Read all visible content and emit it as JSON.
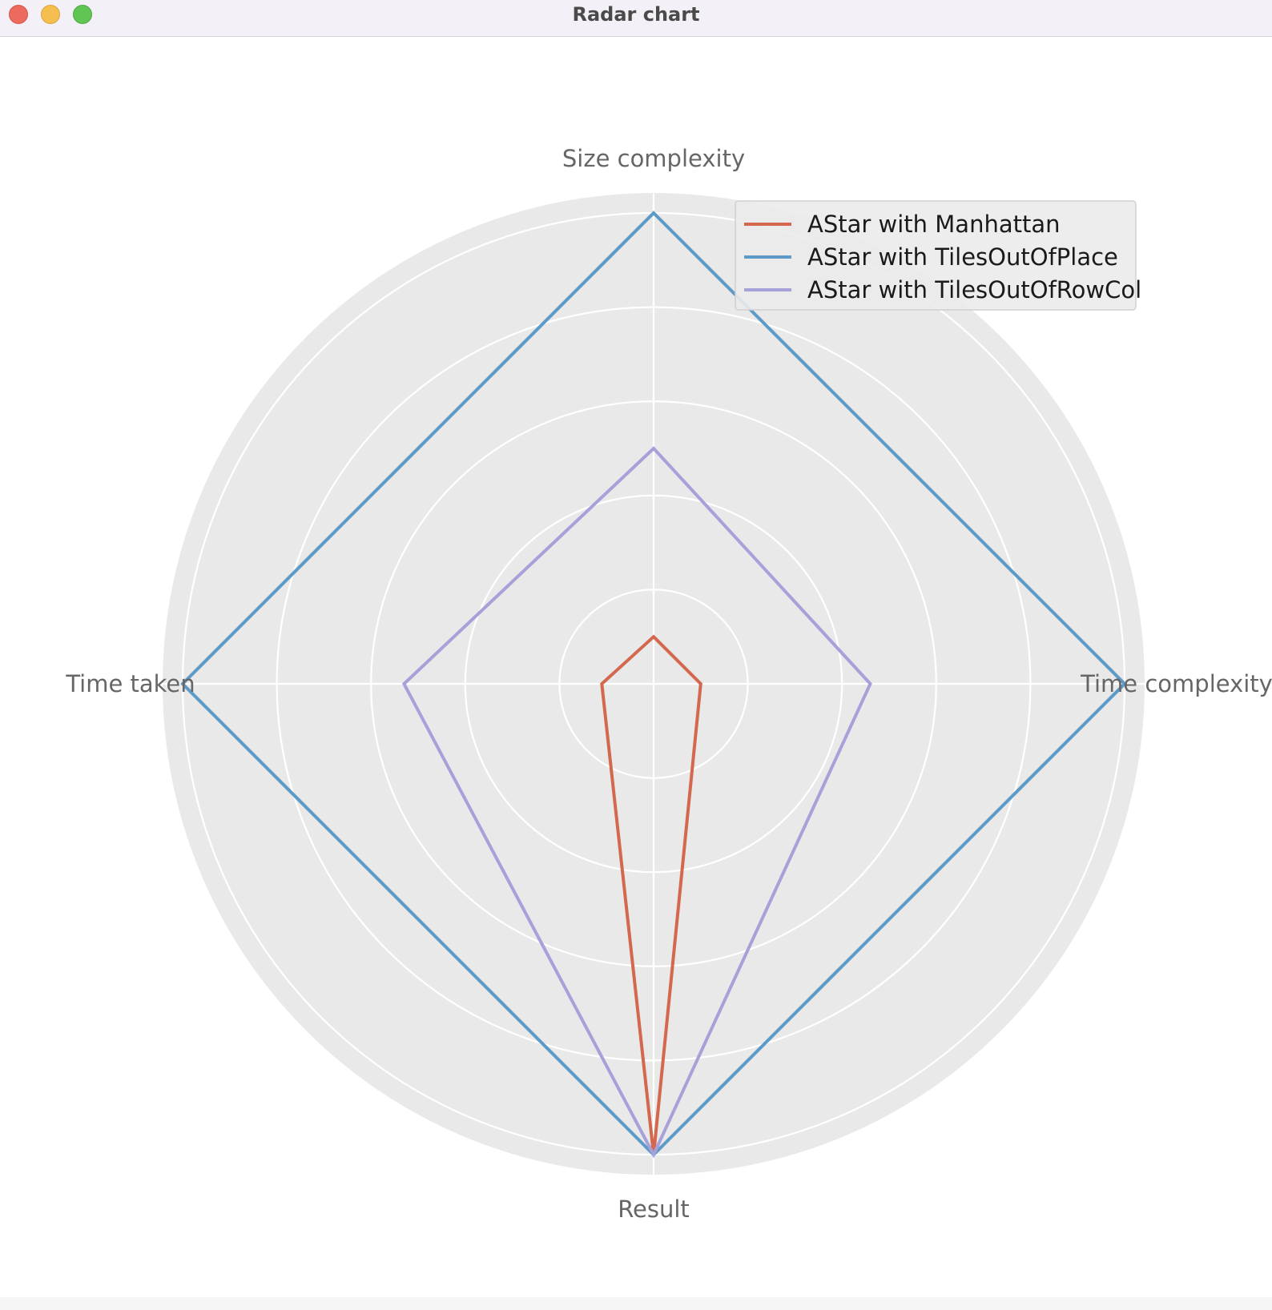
{
  "window": {
    "title": "Radar chart",
    "buttons": [
      "close",
      "minimize",
      "zoom"
    ]
  },
  "chart_data": {
    "type": "radar",
    "axes": [
      "Size complexity",
      "Time complexity",
      "Result",
      "Time taken"
    ],
    "rmax": 1.0,
    "grid_levels": [
      0.2,
      0.4,
      0.6,
      0.8,
      1.0
    ],
    "grid": true,
    "legend_position": "top-right",
    "series": [
      {
        "name": "AStar with Manhattan",
        "color": "#d3684f",
        "values": [
          0.1,
          0.1,
          1.0,
          0.11
        ]
      },
      {
        "name": "AStar with TilesOutOfPlace",
        "color": "#5e9ac7",
        "values": [
          1.0,
          1.0,
          1.0,
          1.0
        ]
      },
      {
        "name": "AStar with TilesOutOfRowCol",
        "color": "#a7a1d9",
        "values": [
          0.5,
          0.46,
          1.0,
          0.53
        ]
      }
    ]
  }
}
